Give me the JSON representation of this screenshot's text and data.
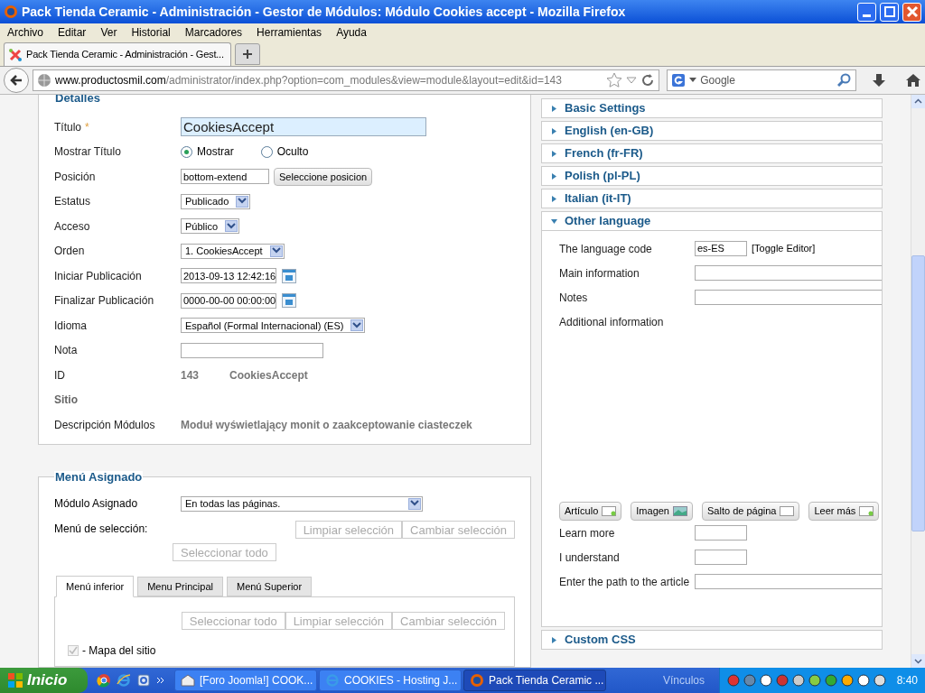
{
  "window": {
    "title": "Pack Tienda Ceramic - Administración - Gestor de Módulos: Módulo Cookies accept - Mozilla Firefox"
  },
  "menu": [
    "Archivo",
    "Editar",
    "Ver",
    "Historial",
    "Marcadores",
    "Herramientas",
    "Ayuda"
  ],
  "browser_tab": {
    "title": "Pack Tienda Ceramic - Administración - Gest..."
  },
  "address": {
    "domain": "www.productosmil.com",
    "path": "/administrator/index.php?option=com_modules&view=module&layout=edit&id=143"
  },
  "search": {
    "placeholder": "Google"
  },
  "details": {
    "legend": "Detalles",
    "fields": [
      {
        "kind": "text",
        "label": "Título",
        "required": "*",
        "value": "CookiesAccept"
      },
      {
        "kind": "radio",
        "label": "Mostrar Título",
        "options": [
          {
            "label": "Mostrar",
            "selected": true
          },
          {
            "label": "Oculto",
            "selected": false
          }
        ]
      },
      {
        "kind": "text_button",
        "label": "Posición",
        "value": "bottom-extend",
        "button": "Seleccione posicion"
      },
      {
        "kind": "select",
        "label": "Estatus",
        "value": "Publicado"
      },
      {
        "kind": "select",
        "label": "Acceso",
        "value": "Público"
      },
      {
        "kind": "select",
        "label": "Orden",
        "value": "1. CookiesAccept"
      },
      {
        "kind": "date",
        "label": "Iniciar Publicación",
        "value": "2013-09-13 12:42:16"
      },
      {
        "kind": "date",
        "label": "Finalizar Publicación",
        "value": "0000-00-00 00:00:00"
      },
      {
        "kind": "select",
        "label": "Idioma",
        "value": "Español (Formal Internacional) (ES)"
      },
      {
        "kind": "input",
        "label": "Nota"
      },
      {
        "kind": "static",
        "label": "ID",
        "values": [
          "143",
          "CookiesAccept"
        ]
      },
      {
        "kind": "heading",
        "label": "Sitio"
      },
      {
        "kind": "static",
        "label": "Descripción Módulos",
        "values": [
          "Moduł wyświetlający monit o zaakceptowanie ciasteczek"
        ]
      }
    ]
  },
  "menu_assignment": {
    "legend": "Menú Asignado",
    "module_label": "Módulo Asignado",
    "module_value": "En todas las páginas.",
    "selection_label": "Menú de selección:",
    "buttons": [
      {
        "label": "Limpiar selección",
        "disabled": true
      },
      {
        "label": "Cambiar selección",
        "disabled": true
      },
      {
        "label": "Seleccionar todo",
        "disabled": true
      }
    ],
    "tabs": [
      {
        "label": "Menú inferior",
        "selected": true
      },
      {
        "label": "Menu Principal",
        "selected": false
      },
      {
        "label": "Menú Superior",
        "selected": false
      }
    ],
    "tab_buttons": [
      {
        "label": "Seleccionar todo",
        "disabled": true
      },
      {
        "label": "Limpiar selección",
        "disabled": true
      },
      {
        "label": "Cambiar selección",
        "disabled": true
      }
    ],
    "items": [
      {
        "label": "- Mapa del sitio",
        "checked": true,
        "disabled": true
      }
    ]
  },
  "accordion": [
    {
      "title": "Basic Settings",
      "expanded": false
    },
    {
      "title": "English (en-GB)",
      "expanded": false
    },
    {
      "title": "French (fr-FR)",
      "expanded": false
    },
    {
      "title": "Polish (pl-PL)",
      "expanded": false
    },
    {
      "title": "Italian (it-IT)",
      "expanded": false
    },
    {
      "title": "Other language",
      "expanded": true,
      "fields": [
        {
          "kind": "code",
          "label": "The language code",
          "value": "es-ES",
          "link": "[Toggle Editor]"
        },
        {
          "kind": "wide",
          "label": "Main information"
        },
        {
          "kind": "wide",
          "label": "Notes"
        },
        {
          "kind": "editor",
          "label": "Additional information",
          "buttons": [
            "Artículo",
            "Imagen",
            "Salto de página",
            "Leer más"
          ]
        },
        {
          "kind": "short",
          "label": "Learn more"
        },
        {
          "kind": "short",
          "label": "I understand"
        },
        {
          "kind": "wide",
          "label": "Enter the path to the article"
        }
      ]
    },
    {
      "title": "Custom CSS",
      "expanded": false
    }
  ],
  "taskbar": {
    "start": "Inicio",
    "tasks": [
      {
        "label": "[Foro Joomla!] COOK...",
        "active": false
      },
      {
        "label": "COOKIES - Hosting J...",
        "active": false
      },
      {
        "label": "Pack Tienda Ceramic ...",
        "active": true
      }
    ],
    "links": "Vínculos",
    "clock": "8:40"
  }
}
